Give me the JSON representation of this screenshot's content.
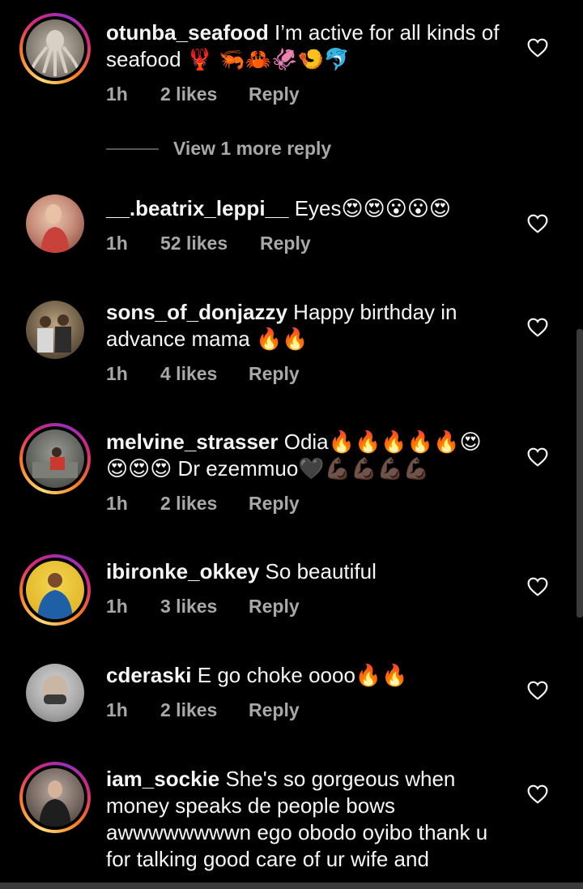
{
  "comments": [
    {
      "username": "otunba_seafood",
      "text": "I’m active for all kinds of seafood 🦞 🦐🦀🦑🍤🐬",
      "time": "1h",
      "likes": "2 likes",
      "reply": "Reply",
      "story_ring": true
    },
    {
      "username": "__.beatrix_leppi__",
      "text": "Eyes😍😍😮😮😍",
      "time": "1h",
      "likes": "52 likes",
      "reply": "Reply",
      "story_ring": false
    },
    {
      "username": "sons_of_donjazzy",
      "text": "Happy birthday in advance mama 🔥🔥",
      "time": "1h",
      "likes": "4 likes",
      "reply": "Reply",
      "story_ring": false
    },
    {
      "username": "melvine_strasser",
      "text": "Odia🔥🔥🔥🔥🔥😍😍😍😍 Dr ezemmuo🖤💪🏿💪🏿💪🏿💪🏿",
      "time": "1h",
      "likes": "2 likes",
      "reply": "Reply",
      "story_ring": true
    },
    {
      "username": "ibironke_okkey",
      "text": "So beautiful",
      "time": "1h",
      "likes": "3 likes",
      "reply": "Reply",
      "story_ring": true
    },
    {
      "username": "cderaski",
      "text": "E go choke oooo🔥🔥",
      "time": "1h",
      "likes": "2 likes",
      "reply": "Reply",
      "story_ring": false
    },
    {
      "username": "iam_sockie",
      "text": "She's so gorgeous when money speaks de people bows awwwwwwwwn ego obodo oyibo thank u for talking good care of ur wife and",
      "time": "",
      "likes": "",
      "reply": "",
      "story_ring": true
    }
  ],
  "view_more_replies": "View 1 more reply",
  "icons": {
    "like": "heart-outline-icon"
  },
  "colors": {
    "background": "#000000",
    "text": "#f5f5f5",
    "muted": "#a8a8a8"
  }
}
